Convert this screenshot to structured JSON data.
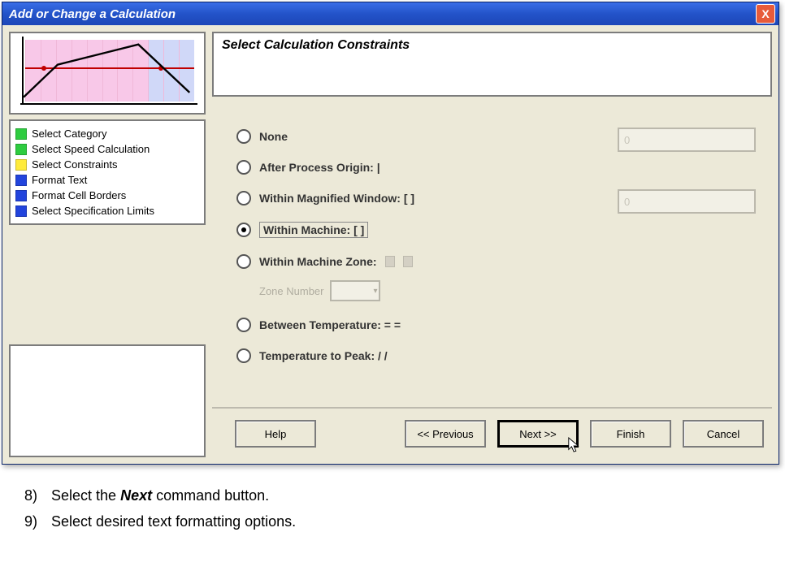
{
  "window": {
    "title": "Add or Change a Calculation"
  },
  "steps": [
    {
      "color": "green",
      "label": "Select Category"
    },
    {
      "color": "green",
      "label": "Select Speed Calculation"
    },
    {
      "color": "yellow",
      "label": "Select Constraints"
    },
    {
      "color": "blue",
      "label": "Format Text"
    },
    {
      "color": "blue",
      "label": "Format Cell Borders"
    },
    {
      "color": "blue",
      "label": "Select Specification Limits"
    }
  ],
  "panel": {
    "title": "Select Calculation Constraints"
  },
  "radios": {
    "none": "None",
    "after_origin": "After Process Origin: |",
    "within_magnified": "Within Magnified Window: [  ]",
    "within_machine": "Within Machine: [ ]",
    "within_zone": "Within Machine Zone:",
    "zone_sub": "Zone Number",
    "between_temp": "Between Temperature: = =",
    "temp_to_peak": "Temperature to Peak: / /"
  },
  "fields": {
    "f1_label": "",
    "f1_value": "0",
    "f2_label": "",
    "f2_value": "0"
  },
  "buttons": {
    "help": "Help",
    "prev": "<< Previous",
    "next": "Next >>",
    "finish": "Finish",
    "cancel": "Cancel"
  },
  "instructions": {
    "i8_num": "8)",
    "i8_a": "Select the ",
    "i8_b": "Next",
    "i8_c": " command button.",
    "i9_num": "9)",
    "i9": "Select desired text formatting options."
  }
}
